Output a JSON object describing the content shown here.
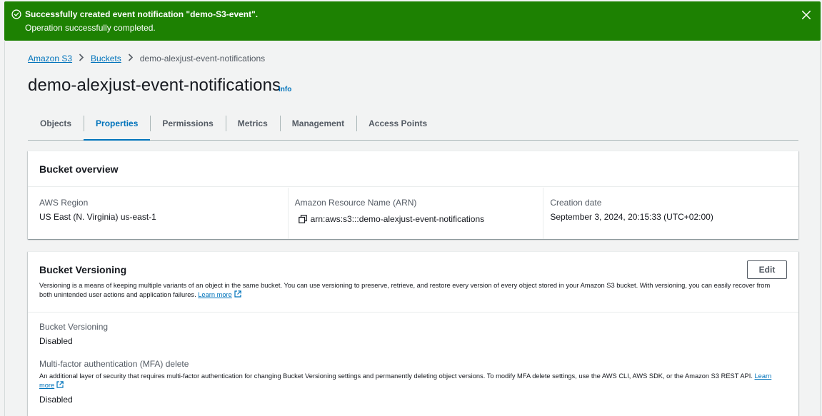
{
  "flash": {
    "title": "Successfully created event notification \"demo-S3-event\".",
    "message": "Operation successfully completed."
  },
  "breadcrumb": {
    "items": [
      "Amazon S3",
      "Buckets"
    ],
    "current": "demo-alexjust-event-notifications"
  },
  "page": {
    "title": "demo-alexjust-event-notifications",
    "info_label": "Info"
  },
  "tabs": [
    {
      "label": "Objects"
    },
    {
      "label": "Properties"
    },
    {
      "label": "Permissions"
    },
    {
      "label": "Metrics"
    },
    {
      "label": "Management"
    },
    {
      "label": "Access Points"
    }
  ],
  "active_tab": "Properties",
  "overview": {
    "title": "Bucket overview",
    "region_label": "AWS Region",
    "region_value": "US East (N. Virginia) us-east-1",
    "arn_label": "Amazon Resource Name (ARN)",
    "arn_value": "arn:aws:s3:::demo-alexjust-event-notifications",
    "created_label": "Creation date",
    "created_value": "September 3, 2024, 20:15:33 (UTC+02:00)"
  },
  "versioning": {
    "title": "Bucket Versioning",
    "edit_label": "Edit",
    "description": "Versioning is a means of keeping multiple variants of an object in the same bucket. You can use versioning to preserve, retrieve, and restore every version of every object stored in your Amazon S3 bucket. With versioning, you can easily recover from both unintended user actions and application failures.",
    "learn_more": "Learn more",
    "status_label": "Bucket Versioning",
    "status_value": "Disabled",
    "mfa_label": "Multi-factor authentication (MFA) delete",
    "mfa_description": "An additional layer of security that requires multi-factor authentication for changing Bucket Versioning settings and permanently deleting object versions. To modify MFA delete settings, use the AWS CLI, AWS SDK, or the Amazon S3 REST API.",
    "mfa_learn_more": "Learn more",
    "mfa_value": "Disabled"
  },
  "colors": {
    "success": "#1d8102",
    "link": "#0073bb",
    "text": "#16191f",
    "muted": "#545b64",
    "background": "#f2f3f3"
  },
  "icons": {
    "flash": "check-circle-icon",
    "dismiss": "close-icon",
    "breadcrumb_separator": "chevron-right-icon",
    "copy": "copy-icon",
    "external": "external-link-icon"
  }
}
